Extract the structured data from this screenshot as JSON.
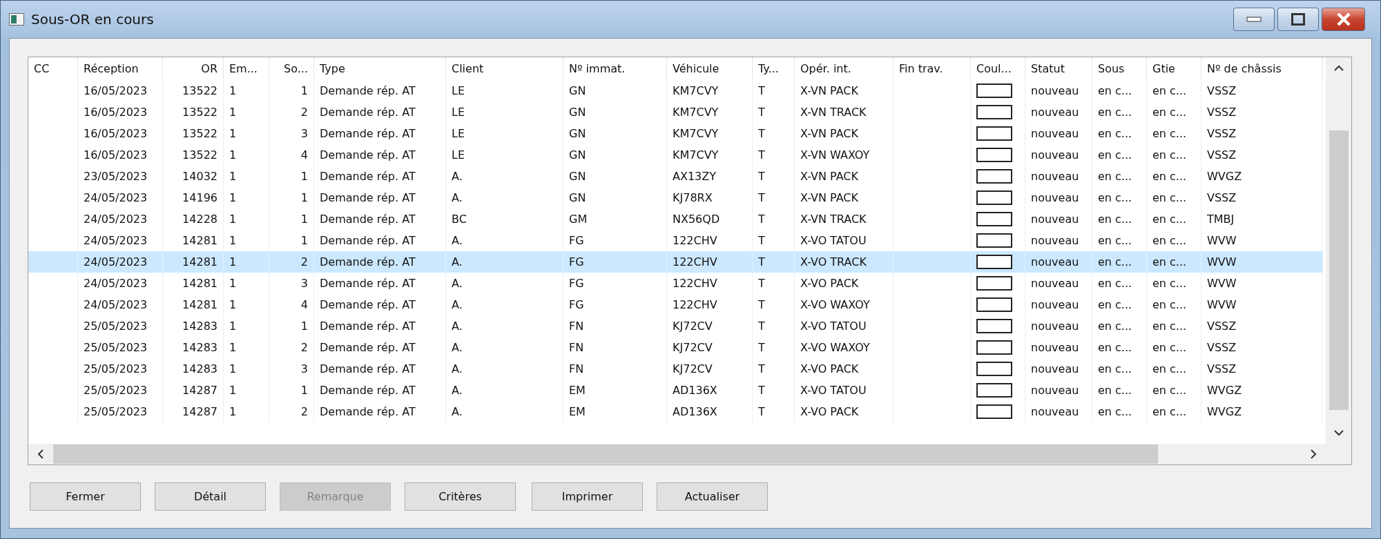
{
  "window": {
    "title": "Sous-OR en cours"
  },
  "table": {
    "columns": [
      "CC",
      "Réception",
      "OR",
      "Em...",
      "So...",
      "Type",
      "Client",
      "Nº immat.",
      "Véhicule",
      "Ty...",
      "Opér. int.",
      "Fin trav.",
      "Coul...",
      "Statut",
      "Sous",
      "Gtie",
      "Nº de châssis"
    ],
    "rows": [
      {
        "reception": "16/05/2023",
        "or": "13522",
        "em": "1",
        "so": "1",
        "type": "Demande rép. AT",
        "client": "LE",
        "immat": "GN",
        "vehicule": "KM7CVY",
        "ty": "T",
        "oper": "X-VN PACK",
        "statut": "nouveau",
        "sous": "en c...",
        "gtie": "en c...",
        "chassis": "VSSZ",
        "selected": false
      },
      {
        "reception": "16/05/2023",
        "or": "13522",
        "em": "1",
        "so": "2",
        "type": "Demande rép. AT",
        "client": "LE",
        "immat": "GN",
        "vehicule": "KM7CVY",
        "ty": "T",
        "oper": "X-VN TRACK",
        "statut": "nouveau",
        "sous": "en c...",
        "gtie": "en c...",
        "chassis": "VSSZ",
        "selected": false
      },
      {
        "reception": "16/05/2023",
        "or": "13522",
        "em": "1",
        "so": "3",
        "type": "Demande rép. AT",
        "client": "LE",
        "immat": "GN",
        "vehicule": "KM7CVY",
        "ty": "T",
        "oper": "X-VN PACK",
        "statut": "nouveau",
        "sous": "en c...",
        "gtie": "en c...",
        "chassis": "VSSZ",
        "selected": false
      },
      {
        "reception": "16/05/2023",
        "or": "13522",
        "em": "1",
        "so": "4",
        "type": "Demande rép. AT",
        "client": "LE",
        "immat": "GN",
        "vehicule": "KM7CVY",
        "ty": "T",
        "oper": "X-VN WAXOY",
        "statut": "nouveau",
        "sous": "en c...",
        "gtie": "en c...",
        "chassis": "VSSZ",
        "selected": false
      },
      {
        "reception": "23/05/2023",
        "or": "14032",
        "em": "1",
        "so": "1",
        "type": "Demande rép. AT",
        "client": "A.",
        "immat": "GN",
        "vehicule": "AX13ZY",
        "ty": "T",
        "oper": "X-VN PACK",
        "statut": "nouveau",
        "sous": "en c...",
        "gtie": "en c...",
        "chassis": "WVGZ",
        "selected": false
      },
      {
        "reception": "24/05/2023",
        "or": "14196",
        "em": "1",
        "so": "1",
        "type": "Demande rép. AT",
        "client": "A.",
        "immat": "GN",
        "vehicule": "KJ78RX",
        "ty": "T",
        "oper": "X-VN PACK",
        "statut": "nouveau",
        "sous": "en c...",
        "gtie": "en c...",
        "chassis": "VSSZ",
        "selected": false
      },
      {
        "reception": "24/05/2023",
        "or": "14228",
        "em": "1",
        "so": "1",
        "type": "Demande rép. AT",
        "client": "BC",
        "immat": "GM",
        "vehicule": "NX56QD",
        "ty": "T",
        "oper": "X-VN TRACK",
        "statut": "nouveau",
        "sous": "en c...",
        "gtie": "en c...",
        "chassis": "TMBJ",
        "selected": false
      },
      {
        "reception": "24/05/2023",
        "or": "14281",
        "em": "1",
        "so": "1",
        "type": "Demande rép. AT",
        "client": "A.",
        "immat": "FG",
        "vehicule": "122CHV",
        "ty": "T",
        "oper": "X-VO TATOU",
        "statut": "nouveau",
        "sous": "en c...",
        "gtie": "en c...",
        "chassis": "WVW",
        "selected": false
      },
      {
        "reception": "24/05/2023",
        "or": "14281",
        "em": "1",
        "so": "2",
        "type": "Demande rép. AT",
        "client": "A.",
        "immat": "FG",
        "vehicule": "122CHV",
        "ty": "T",
        "oper": "X-VO TRACK",
        "statut": "nouveau",
        "sous": "en c...",
        "gtie": "en c...",
        "chassis": "WVW",
        "selected": true
      },
      {
        "reception": "24/05/2023",
        "or": "14281",
        "em": "1",
        "so": "3",
        "type": "Demande rép. AT",
        "client": "A.",
        "immat": "FG",
        "vehicule": "122CHV",
        "ty": "T",
        "oper": "X-VO PACK",
        "statut": "nouveau",
        "sous": "en c...",
        "gtie": "en c...",
        "chassis": "WVW",
        "selected": false
      },
      {
        "reception": "24/05/2023",
        "or": "14281",
        "em": "1",
        "so": "4",
        "type": "Demande rép. AT",
        "client": "A.",
        "immat": "FG",
        "vehicule": "122CHV",
        "ty": "T",
        "oper": "X-VO WAXOY",
        "statut": "nouveau",
        "sous": "en c...",
        "gtie": "en c...",
        "chassis": "WVW",
        "selected": false
      },
      {
        "reception": "25/05/2023",
        "or": "14283",
        "em": "1",
        "so": "1",
        "type": "Demande rép. AT",
        "client": "A.",
        "immat": "FN",
        "vehicule": "KJ72CV",
        "ty": "T",
        "oper": "X-VO TATOU",
        "statut": "nouveau",
        "sous": "en c...",
        "gtie": "en c...",
        "chassis": "VSSZ",
        "selected": false
      },
      {
        "reception": "25/05/2023",
        "or": "14283",
        "em": "1",
        "so": "2",
        "type": "Demande rép. AT",
        "client": "A.",
        "immat": "FN",
        "vehicule": "KJ72CV",
        "ty": "T",
        "oper": "X-VO WAXOY",
        "statut": "nouveau",
        "sous": "en c...",
        "gtie": "en c...",
        "chassis": "VSSZ",
        "selected": false
      },
      {
        "reception": "25/05/2023",
        "or": "14283",
        "em": "1",
        "so": "3",
        "type": "Demande rép. AT",
        "client": "A.",
        "immat": "FN",
        "vehicule": "KJ72CV",
        "ty": "T",
        "oper": "X-VO PACK",
        "statut": "nouveau",
        "sous": "en c...",
        "gtie": "en c...",
        "chassis": "VSSZ",
        "selected": false
      },
      {
        "reception": "25/05/2023",
        "or": "14287",
        "em": "1",
        "so": "1",
        "type": "Demande rép. AT",
        "client": "A.",
        "immat": "EM",
        "vehicule": "AD136X",
        "ty": "T",
        "oper": "X-VO TATOU",
        "statut": "nouveau",
        "sous": "en c...",
        "gtie": "en c...",
        "chassis": "WVGZ",
        "selected": false
      },
      {
        "reception": "25/05/2023",
        "or": "14287",
        "em": "1",
        "so": "2",
        "type": "Demande rép. AT",
        "client": "A.",
        "immat": "EM",
        "vehicule": "AD136X",
        "ty": "T",
        "oper": "X-VO PACK",
        "statut": "nouveau",
        "sous": "en c...",
        "gtie": "en c...",
        "chassis": "WVGZ",
        "selected": false
      }
    ]
  },
  "buttons": [
    {
      "label": "Fermer",
      "disabled": false
    },
    {
      "label": "Détail",
      "disabled": false
    },
    {
      "label": "Remarque",
      "disabled": true
    },
    {
      "label": "Critères",
      "disabled": false
    },
    {
      "label": "Imprimer",
      "disabled": false
    },
    {
      "label": "Actualiser",
      "disabled": false
    }
  ]
}
